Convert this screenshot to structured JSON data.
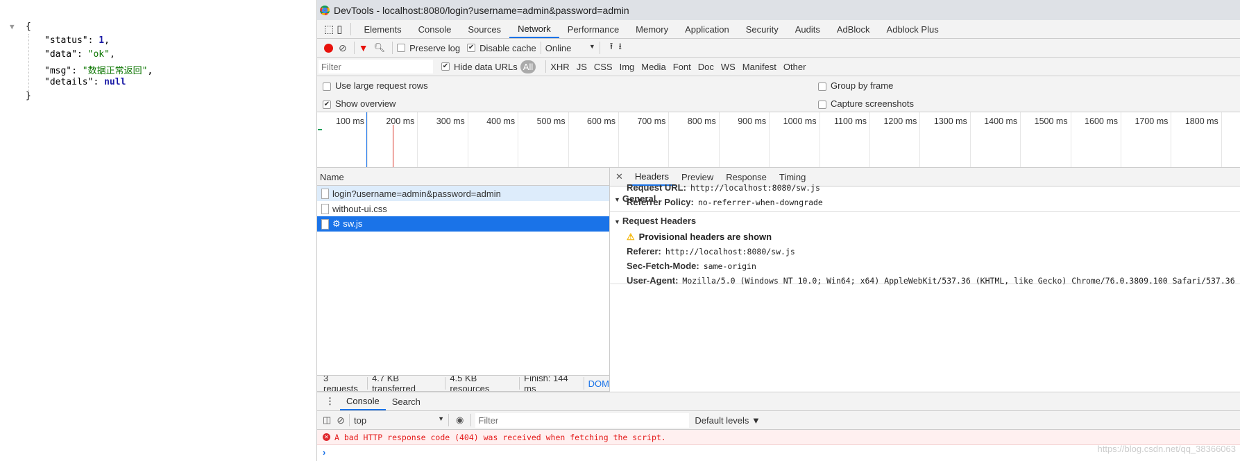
{
  "json_view": {
    "open": "{",
    "close": "}",
    "lines": [
      {
        "key": "\"status\": ",
        "value": "1",
        "suffix": ",",
        "kind": "number"
      },
      {
        "key": "\"data\": ",
        "value": "\"ok\"",
        "suffix": ",",
        "kind": "string"
      },
      {
        "key": "\"msg\": ",
        "value": "\"数据正常返回\"",
        "suffix": ",",
        "kind": "string"
      },
      {
        "key": "\"details\": ",
        "value": "null",
        "suffix": "",
        "kind": "null"
      }
    ]
  },
  "window": {
    "title": "DevTools - localhost:8080/login?username=admin&password=admin"
  },
  "tabs": [
    "Elements",
    "Console",
    "Sources",
    "Network",
    "Performance",
    "Memory",
    "Application",
    "Security",
    "Audits",
    "AdBlock",
    "Adblock Plus"
  ],
  "active_tab": "Network",
  "toolbar": {
    "preserve_log": "Preserve log",
    "preserve_log_checked": false,
    "disable_cache": "Disable cache",
    "disable_cache_checked": true,
    "throttling": "Online"
  },
  "filter": {
    "placeholder": "Filter",
    "hide_data_urls": "Hide data URLs",
    "types": [
      "All",
      "XHR",
      "JS",
      "CSS",
      "Img",
      "Media",
      "Font",
      "Doc",
      "WS",
      "Manifest",
      "Other"
    ]
  },
  "options": {
    "large_rows": "Use large request rows",
    "show_overview": "Show overview",
    "group_by_frame": "Group by frame",
    "capture_screenshots": "Capture screenshots"
  },
  "timeline": {
    "ticks": [
      "100 ms",
      "200 ms",
      "300 ms",
      "400 ms",
      "500 ms",
      "600 ms",
      "700 ms",
      "800 ms",
      "900 ms",
      "1000 ms",
      "1100 ms",
      "1200 ms",
      "1300 ms",
      "1400 ms",
      "1500 ms",
      "1600 ms",
      "1700 ms",
      "1800 ms",
      "1"
    ],
    "dom_content_loaded_color": "#1a73e8",
    "load_color": "#d93025"
  },
  "requests": {
    "header": "Name",
    "rows": [
      {
        "name": "login?username=admin&password=admin",
        "state": "hover"
      },
      {
        "name": "without-ui.css",
        "state": "normal"
      },
      {
        "name": "⚙ sw.js",
        "state": "selected"
      }
    ]
  },
  "detail_tabs": [
    "Headers",
    "Preview",
    "Response",
    "Timing"
  ],
  "general": {
    "title": "General",
    "items": [
      {
        "k": "Request URL:",
        "v": "http://localhost:8080/sw.js"
      },
      {
        "k": "Referrer Policy:",
        "v": "no-referrer-when-downgrade"
      }
    ]
  },
  "request_headers": {
    "title": "Request Headers",
    "warning": "Provisional headers are shown",
    "items": [
      {
        "k": "Referer:",
        "v": "http://localhost:8080/sw.js"
      },
      {
        "k": "Sec-Fetch-Mode:",
        "v": "same-origin"
      },
      {
        "k": "User-Agent:",
        "v": "Mozilla/5.0 (Windows NT 10.0; Win64; x64) AppleWebKit/537.36 (KHTML, like Gecko) Chrome/76.0.3809.100 Safari/537.36"
      }
    ]
  },
  "status_bar": [
    "3 requests",
    "4.7 KB transferred",
    "4.5 KB resources",
    "Finish: 144 ms",
    "DOM"
  ],
  "drawer": {
    "tabs": [
      "Console",
      "Search"
    ],
    "context": "top",
    "filter_placeholder": "Filter",
    "levels": "Default levels ▼",
    "error": "A bad HTTP response code (404) was received when fetching the script."
  },
  "watermark": "https://blog.csdn.net/qq_38366063"
}
